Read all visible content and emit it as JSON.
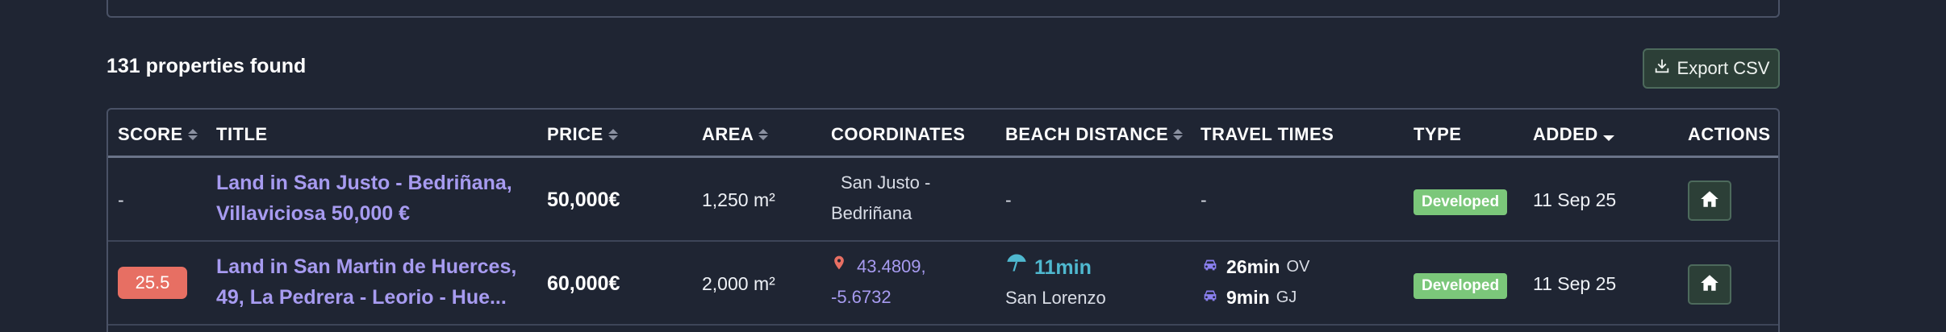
{
  "results": {
    "count_label": "131 properties found"
  },
  "toolbar": {
    "export_label": "Export CSV"
  },
  "columns": {
    "score": "SCORE",
    "title": "TITLE",
    "price": "PRICE",
    "area": "AREA",
    "coordinates": "COORDINATES",
    "beach_distance": "BEACH DISTANCE",
    "travel_times": "TRAVEL TIMES",
    "type": "TYPE",
    "added": "ADDED",
    "actions": "ACTIONS"
  },
  "rows": [
    {
      "score": "-",
      "title_line1": "Land in San Justo - Bedriñana,",
      "title_line2": "Villaviciosa 50,000 €",
      "price": "50,000€",
      "area": "1,250 m²",
      "coord_line1": "San Justo -",
      "coord_line2": "Bedriñana",
      "beach": "-",
      "travel": "-",
      "type": "Developed",
      "added": "11 Sep 25"
    },
    {
      "score": "25.5",
      "title_line1": "Land in San Martin de Huerces,",
      "title_line2": "49, La Pedrera - Leorio - Hue...",
      "price": "60,000€",
      "area": "2,000 m²",
      "coord_line1": "43.4809,",
      "coord_line2": "-5.6732",
      "beach_time": "11min",
      "beach_place": "San Lorenzo",
      "travel_1_time": "26min",
      "travel_1_dest": "OV",
      "travel_2_time": "9min",
      "travel_2_dest": "GJ",
      "type": "Developed",
      "added": "11 Sep 25"
    }
  ],
  "colors": {
    "background": "#1f2533",
    "title_link": "#a79bf0",
    "score_badge": "#e76f63",
    "type_badge": "#7bc77a",
    "beach": "#4fb8cf",
    "button_bg": "#2c3f37"
  },
  "icons": {
    "export": "download-icon",
    "home": "home-icon",
    "map_pin": "map-pin-icon",
    "beach": "umbrella-icon",
    "car": "car-icon"
  }
}
